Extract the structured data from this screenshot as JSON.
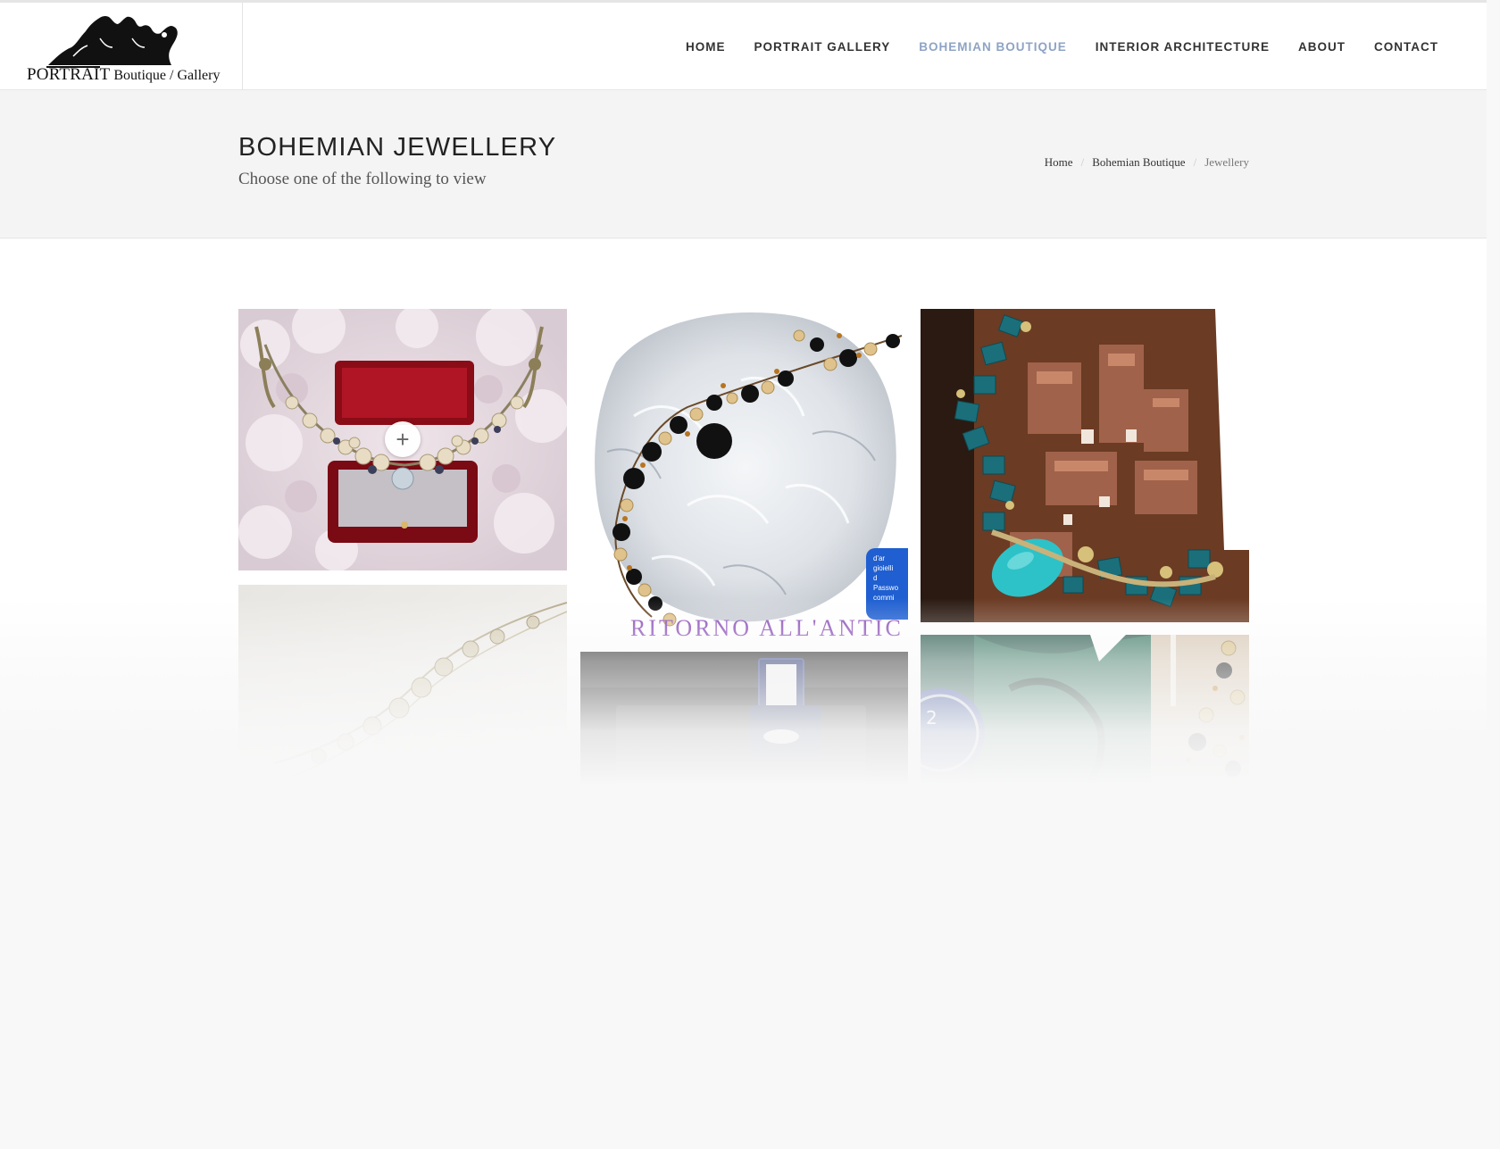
{
  "logo": {
    "title": "PORTRAIT",
    "subtitle": "Boutique / Gallery",
    "icon": "logo-silhouette-icon"
  },
  "nav": {
    "items": [
      {
        "label": "HOME",
        "active": false
      },
      {
        "label": "PORTRAIT GALLERY",
        "active": false
      },
      {
        "label": "BOHEMIAN BOUTIQUE",
        "active": true
      },
      {
        "label": "INTERIOR ARCHITECTURE",
        "active": false
      },
      {
        "label": "ABOUT",
        "active": false
      },
      {
        "label": "CONTACT",
        "active": false
      }
    ],
    "active_color": "#8ea4c4"
  },
  "page": {
    "title": "BOHEMIAN JEWELLERY",
    "subtitle": "Choose one of the following to view"
  },
  "breadcrumb": {
    "items": [
      "Home",
      "Bohemian Boutique",
      "Jewellery"
    ],
    "separator": "/"
  },
  "gallery": {
    "zoom_icon": "plus-icon",
    "zoom_symbol": "+",
    "items": [
      {
        "subject": "pearl necklace in red jewellery box"
      },
      {
        "subject": "black and gold beaded bracelet on glass",
        "caption": "RITORNO ALL'ANTIC",
        "badge_lines": [
          "d'ar",
          "gioielli",
          "d",
          "Passwo",
          "commi"
        ]
      },
      {
        "subject": "turquoise and teal bead necklace over town model"
      },
      {
        "subject": "pearl string necklace"
      },
      {
        "subject": "jewellery box ring"
      },
      {
        "subject": "watch and beaded bracelet"
      }
    ]
  }
}
